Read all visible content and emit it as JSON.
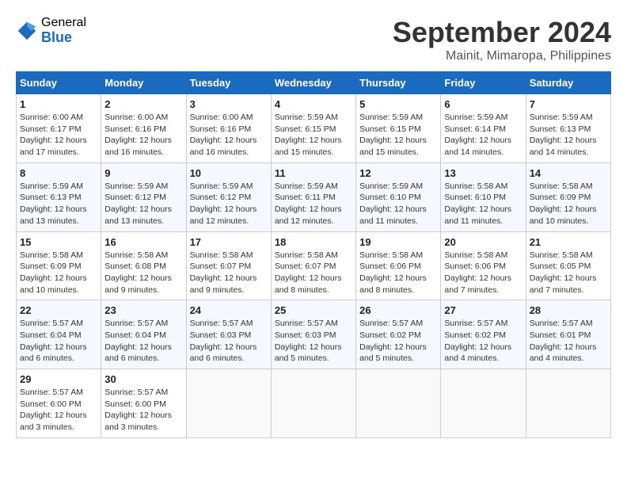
{
  "header": {
    "logo_general": "General",
    "logo_blue": "Blue",
    "main_title": "September 2024",
    "subtitle": "Mainit, Mimaropa, Philippines"
  },
  "calendar": {
    "days_of_week": [
      "Sunday",
      "Monday",
      "Tuesday",
      "Wednesday",
      "Thursday",
      "Friday",
      "Saturday"
    ],
    "weeks": [
      [
        null,
        null,
        null,
        null,
        null,
        null,
        null
      ]
    ],
    "cells": [
      {
        "day": null,
        "content": ""
      },
      {
        "day": null,
        "content": ""
      },
      {
        "day": null,
        "content": ""
      },
      {
        "day": null,
        "content": ""
      },
      {
        "day": null,
        "content": ""
      },
      {
        "day": null,
        "content": ""
      },
      {
        "day": null,
        "content": ""
      }
    ],
    "rows": [
      [
        {
          "day": null
        },
        {
          "day": null
        },
        {
          "day": null
        },
        {
          "day": null
        },
        {
          "day": null
        },
        {
          "day": null
        },
        {
          "day": null
        }
      ]
    ]
  },
  "days": [
    {
      "num": "1",
      "rise": "Sunrise: 6:00 AM",
      "set": "Sunset: 6:17 PM",
      "daylight": "Daylight: 12 hours and 17 minutes."
    },
    {
      "num": "2",
      "rise": "Sunrise: 6:00 AM",
      "set": "Sunset: 6:16 PM",
      "daylight": "Daylight: 12 hours and 16 minutes."
    },
    {
      "num": "3",
      "rise": "Sunrise: 6:00 AM",
      "set": "Sunset: 6:16 PM",
      "daylight": "Daylight: 12 hours and 16 minutes."
    },
    {
      "num": "4",
      "rise": "Sunrise: 5:59 AM",
      "set": "Sunset: 6:15 PM",
      "daylight": "Daylight: 12 hours and 15 minutes."
    },
    {
      "num": "5",
      "rise": "Sunrise: 5:59 AM",
      "set": "Sunset: 6:15 PM",
      "daylight": "Daylight: 12 hours and 15 minutes."
    },
    {
      "num": "6",
      "rise": "Sunrise: 5:59 AM",
      "set": "Sunset: 6:14 PM",
      "daylight": "Daylight: 12 hours and 14 minutes."
    },
    {
      "num": "7",
      "rise": "Sunrise: 5:59 AM",
      "set": "Sunset: 6:13 PM",
      "daylight": "Daylight: 12 hours and 14 minutes."
    },
    {
      "num": "8",
      "rise": "Sunrise: 5:59 AM",
      "set": "Sunset: 6:13 PM",
      "daylight": "Daylight: 12 hours and 13 minutes."
    },
    {
      "num": "9",
      "rise": "Sunrise: 5:59 AM",
      "set": "Sunset: 6:12 PM",
      "daylight": "Daylight: 12 hours and 13 minutes."
    },
    {
      "num": "10",
      "rise": "Sunrise: 5:59 AM",
      "set": "Sunset: 6:12 PM",
      "daylight": "Daylight: 12 hours and 12 minutes."
    },
    {
      "num": "11",
      "rise": "Sunrise: 5:59 AM",
      "set": "Sunset: 6:11 PM",
      "daylight": "Daylight: 12 hours and 12 minutes."
    },
    {
      "num": "12",
      "rise": "Sunrise: 5:59 AM",
      "set": "Sunset: 6:10 PM",
      "daylight": "Daylight: 12 hours and 11 minutes."
    },
    {
      "num": "13",
      "rise": "Sunrise: 5:58 AM",
      "set": "Sunset: 6:10 PM",
      "daylight": "Daylight: 12 hours and 11 minutes."
    },
    {
      "num": "14",
      "rise": "Sunrise: 5:58 AM",
      "set": "Sunset: 6:09 PM",
      "daylight": "Daylight: 12 hours and 10 minutes."
    },
    {
      "num": "15",
      "rise": "Sunrise: 5:58 AM",
      "set": "Sunset: 6:09 PM",
      "daylight": "Daylight: 12 hours and 10 minutes."
    },
    {
      "num": "16",
      "rise": "Sunrise: 5:58 AM",
      "set": "Sunset: 6:08 PM",
      "daylight": "Daylight: 12 hours and 9 minutes."
    },
    {
      "num": "17",
      "rise": "Sunrise: 5:58 AM",
      "set": "Sunset: 6:07 PM",
      "daylight": "Daylight: 12 hours and 9 minutes."
    },
    {
      "num": "18",
      "rise": "Sunrise: 5:58 AM",
      "set": "Sunset: 6:07 PM",
      "daylight": "Daylight: 12 hours and 8 minutes."
    },
    {
      "num": "19",
      "rise": "Sunrise: 5:58 AM",
      "set": "Sunset: 6:06 PM",
      "daylight": "Daylight: 12 hours and 8 minutes."
    },
    {
      "num": "20",
      "rise": "Sunrise: 5:58 AM",
      "set": "Sunset: 6:06 PM",
      "daylight": "Daylight: 12 hours and 7 minutes."
    },
    {
      "num": "21",
      "rise": "Sunrise: 5:58 AM",
      "set": "Sunset: 6:05 PM",
      "daylight": "Daylight: 12 hours and 7 minutes."
    },
    {
      "num": "22",
      "rise": "Sunrise: 5:57 AM",
      "set": "Sunset: 6:04 PM",
      "daylight": "Daylight: 12 hours and 6 minutes."
    },
    {
      "num": "23",
      "rise": "Sunrise: 5:57 AM",
      "set": "Sunset: 6:04 PM",
      "daylight": "Daylight: 12 hours and 6 minutes."
    },
    {
      "num": "24",
      "rise": "Sunrise: 5:57 AM",
      "set": "Sunset: 6:03 PM",
      "daylight": "Daylight: 12 hours and 6 minutes."
    },
    {
      "num": "25",
      "rise": "Sunrise: 5:57 AM",
      "set": "Sunset: 6:03 PM",
      "daylight": "Daylight: 12 hours and 5 minutes."
    },
    {
      "num": "26",
      "rise": "Sunrise: 5:57 AM",
      "set": "Sunset: 6:02 PM",
      "daylight": "Daylight: 12 hours and 5 minutes."
    },
    {
      "num": "27",
      "rise": "Sunrise: 5:57 AM",
      "set": "Sunset: 6:02 PM",
      "daylight": "Daylight: 12 hours and 4 minutes."
    },
    {
      "num": "28",
      "rise": "Sunrise: 5:57 AM",
      "set": "Sunset: 6:01 PM",
      "daylight": "Daylight: 12 hours and 4 minutes."
    },
    {
      "num": "29",
      "rise": "Sunrise: 5:57 AM",
      "set": "Sunset: 6:00 PM",
      "daylight": "Daylight: 12 hours and 3 minutes."
    },
    {
      "num": "30",
      "rise": "Sunrise: 5:57 AM",
      "set": "Sunset: 6:00 PM",
      "daylight": "Daylight: 12 hours and 3 minutes."
    }
  ],
  "col_headers": [
    "Sunday",
    "Monday",
    "Tuesday",
    "Wednesday",
    "Thursday",
    "Friday",
    "Saturday"
  ]
}
